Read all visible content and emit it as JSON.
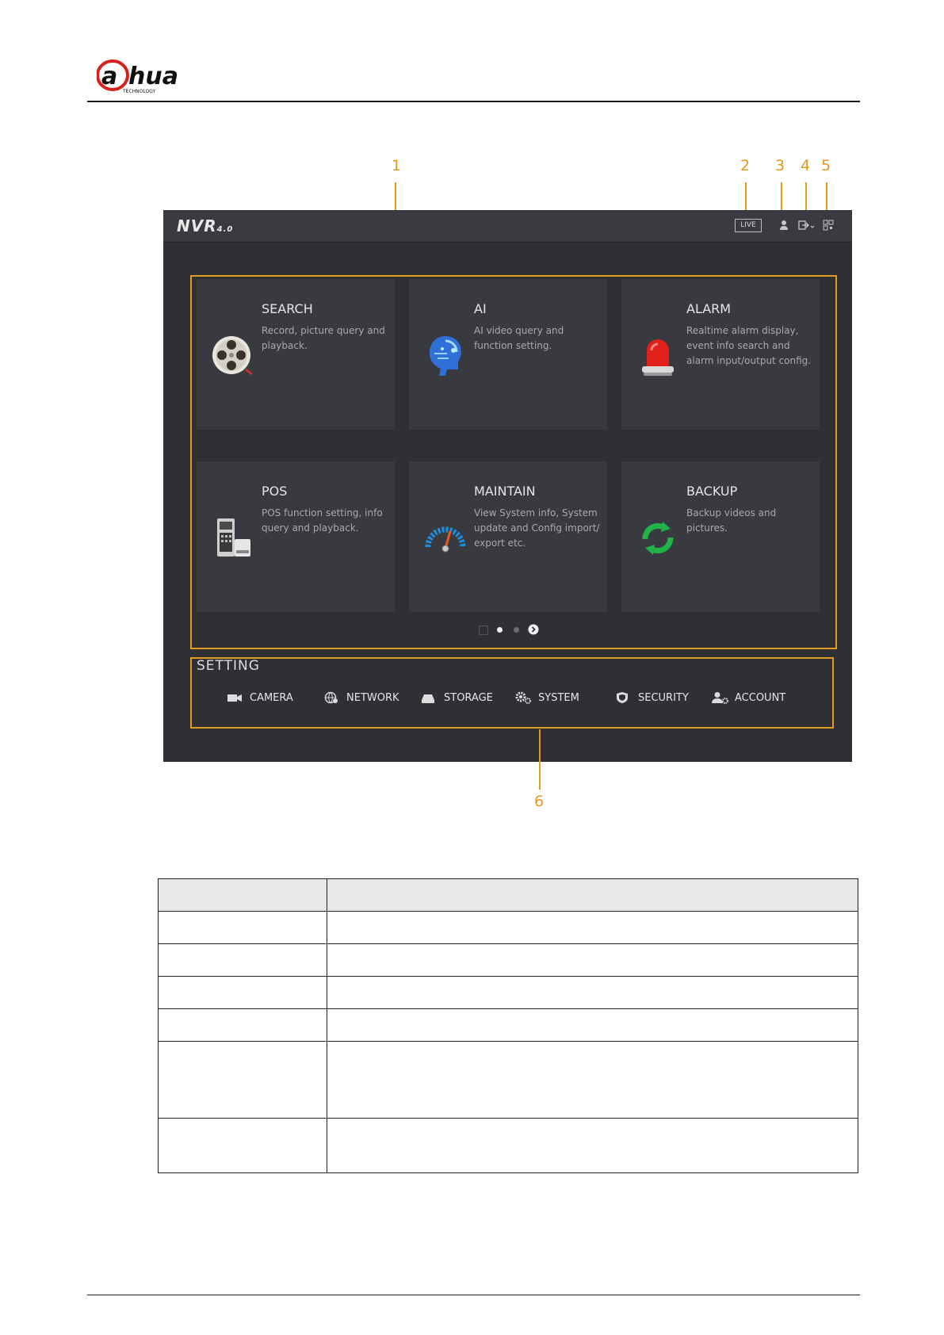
{
  "brand": {
    "logo_text": "alhua",
    "logo_sub": "TECHNOLOGY"
  },
  "callouts": [
    "1",
    "2",
    "3",
    "4",
    "5",
    "6"
  ],
  "screen": {
    "logo": "NVR",
    "version": "4.0",
    "live_label": "LIVE",
    "icons": [
      "user-icon",
      "logout-icon",
      "qr-code-icon"
    ],
    "tiles": [
      {
        "title": "SEARCH",
        "desc": "Record, picture query and playback.",
        "icon": "film-reel-icon"
      },
      {
        "title": "AI",
        "desc": "AI video query and function setting.",
        "icon": "ai-head-icon"
      },
      {
        "title": "ALARM",
        "desc": "Realtime alarm display, event info search and alarm input/output config.",
        "icon": "alarm-light-icon"
      },
      {
        "title": "POS",
        "desc": "POS function setting, info query and playback.",
        "icon": "pos-terminal-icon"
      },
      {
        "title": "MAINTAIN",
        "desc": "View System info, System update and Config import/ export etc.",
        "icon": "gauge-icon"
      },
      {
        "title": "BACKUP",
        "desc": "Backup videos and pictures.",
        "icon": "sync-arrows-icon"
      }
    ],
    "pager": {
      "current": 2,
      "total": 3
    },
    "setting": {
      "title": "SETTING",
      "items": [
        {
          "label": "CAMERA",
          "icon": "camera-icon"
        },
        {
          "label": "NETWORK",
          "icon": "network-globe-icon"
        },
        {
          "label": "STORAGE",
          "icon": "storage-drive-icon"
        },
        {
          "label": "SYSTEM",
          "icon": "gears-icon"
        },
        {
          "label": "SECURITY",
          "icon": "shield-icon"
        },
        {
          "label": "ACCOUNT",
          "icon": "account-icon"
        }
      ]
    }
  },
  "colors": {
    "accent": "#e39b1f",
    "screen_bg": "#2f3035",
    "tile_bg": "#393a40"
  }
}
